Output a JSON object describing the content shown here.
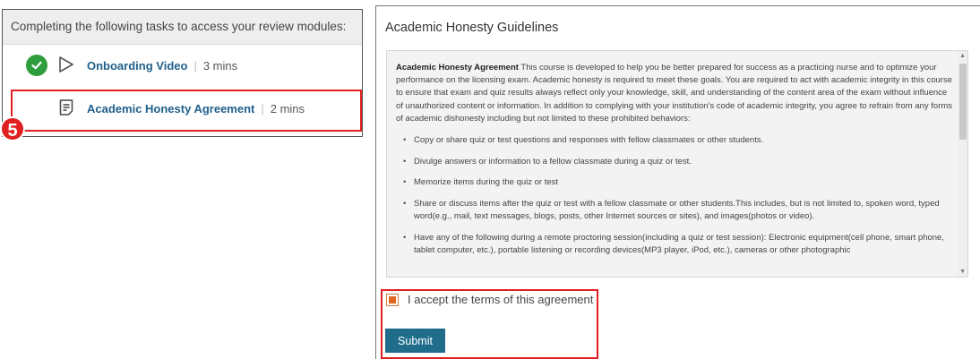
{
  "tasks_panel": {
    "header": "Completing the following tasks to access your review modules:",
    "tasks": [
      {
        "title": "Onboarding Video",
        "duration": "3 mins",
        "status_icon": "check-circle-icon",
        "type_icon": "play-icon"
      },
      {
        "title": "Academic Honesty Agreement",
        "duration": "2 mins",
        "type_icon": "document-icon"
      }
    ],
    "step_badge": "5"
  },
  "guidelines": {
    "title": "Academic Honesty Guidelines",
    "intro_bold": "Academic Honesty Agreement",
    "intro_text": " This course is developed to help you be better prepared for success as a practicing nurse and to optimize your performance on the licensing exam. Academic honesty is required to meet these goals. You are required to act with academic integrity in this course to ensure that exam and quiz results always reflect only your knowledge, skill, and understanding of the content area of the exam without influence of unauthorized content or information. In addition to complying with your institution's code of academic integrity, you agree to refrain from any forms of academic dishonesty including but not limited to these prohibited behaviors:",
    "bullets": [
      "Copy or share quiz or test questions and responses with fellow classmates or other students.",
      "Divulge answers or information to a fellow classmate during a quiz or test.",
      "Memorize items during the quiz or test",
      "Share or discuss items after the quiz or test with a fellow classmate or other students.This includes, but is not limited to, spoken word, typed word(e.g., mail, text messages, blogs, posts, other Internet sources or sites), and images(photos or video).",
      "Have any of the following during a remote proctoring session(including a quiz or test session): Electronic equipment(cell phone, smart phone, tablet computer, etc.), portable listening or recording devices(MP3 player, iPod, etc.), cameras or other photographic"
    ]
  },
  "accept": {
    "label": "I accept the terms of this agreement",
    "checked": true
  },
  "submit": {
    "label": "Submit"
  },
  "colors": {
    "accent_blue": "#1f6c8b",
    "check_green": "#2e9d3d",
    "highlight_red": "#e02020",
    "checkbox_orange": "#e0651f"
  }
}
